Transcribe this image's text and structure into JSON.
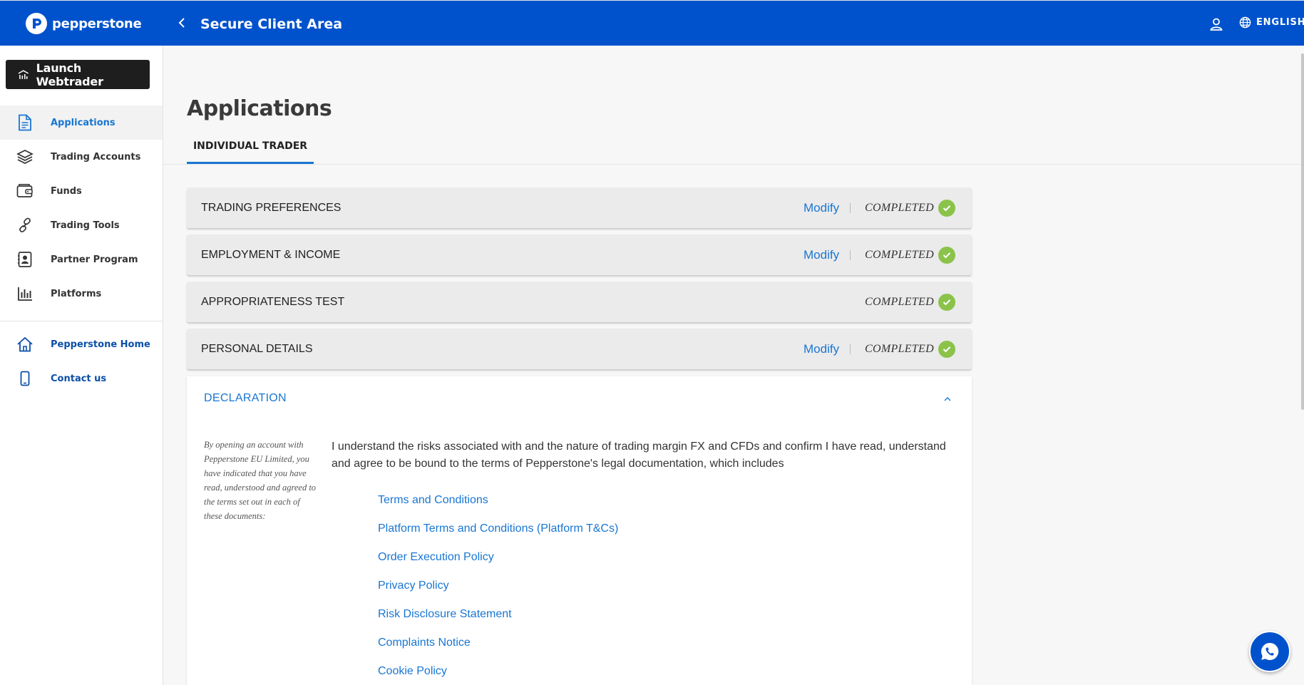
{
  "header": {
    "brand": "pepperstone",
    "title": "Secure Client Area",
    "language": "ENGLISH"
  },
  "sidebar": {
    "launch_label": "Launch Webtrader",
    "items": [
      {
        "label": "Applications",
        "icon": "document-icon",
        "active": true
      },
      {
        "label": "Trading Accounts",
        "icon": "layers-icon"
      },
      {
        "label": "Funds",
        "icon": "wallet-icon"
      },
      {
        "label": "Trading Tools",
        "icon": "link-icon"
      },
      {
        "label": "Partner Program",
        "icon": "contact-card-icon"
      },
      {
        "label": "Platforms",
        "icon": "bar-chart-icon"
      }
    ],
    "secondary": [
      {
        "label": "Pepperstone Home",
        "icon": "home-icon"
      },
      {
        "label": "Contact us",
        "icon": "phone-icon"
      }
    ]
  },
  "main": {
    "title": "Applications",
    "tab": "INDIVIDUAL TRADER",
    "sections": [
      {
        "title": "TRADING PREFERENCES",
        "action": "Modify",
        "status": "COMPLETED"
      },
      {
        "title": "EMPLOYMENT & INCOME",
        "action": "Modify",
        "status": "COMPLETED"
      },
      {
        "title": "APPROPRIATENESS TEST",
        "action": "",
        "status": "COMPLETED"
      },
      {
        "title": "PERSONAL DETAILS",
        "action": "Modify",
        "status": "COMPLETED"
      }
    ],
    "declaration": {
      "title": "DECLARATION",
      "side_note": "By opening an account with Pepperstone EU Limited, you have indicated that you have read, understood and agreed to the terms set out in each of these documents:",
      "text": "I understand the risks associated with and the nature of trading margin FX and CFDs and confirm I have read, understand and agree to be bound to the terms of Pepperstone's legal documentation, which includes",
      "links": [
        "Terms and Conditions",
        "Platform Terms and Conditions (Platform T&Cs)",
        "Order Execution Policy",
        "Privacy Policy",
        "Risk Disclosure Statement",
        "Complaints Notice",
        "Cookie Policy"
      ]
    }
  },
  "colors": {
    "brand_blue": "#0052cc",
    "link_blue": "#1976d2",
    "completed_green": "#8bc34a",
    "launch_bg": "#1e1e1e"
  }
}
